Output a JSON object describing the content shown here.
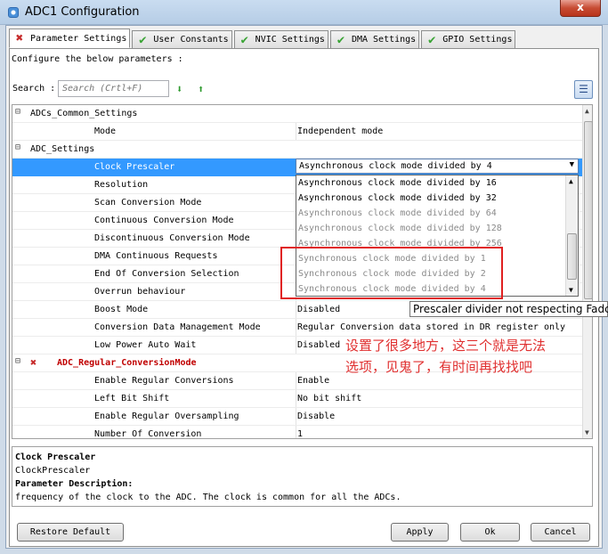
{
  "window": {
    "title": "ADC1 Configuration",
    "close_glyph": "x"
  },
  "tabs": [
    {
      "label": "Parameter Settings",
      "icon": "error-x-icon",
      "active": true
    },
    {
      "label": "User Constants",
      "icon": "check-icon"
    },
    {
      "label": "NVIC Settings",
      "icon": "check-icon"
    },
    {
      "label": "DMA Settings",
      "icon": "check-icon"
    },
    {
      "label": "GPIO Settings",
      "icon": "check-icon"
    }
  ],
  "config_label": "Configure the below parameters :",
  "search": {
    "label": "Search :",
    "placeholder": "Search (Crtl+F)"
  },
  "grid": {
    "groups": {
      "common": "ADCs_Common_Settings",
      "adc": "ADC_Settings",
      "regular": "ADC_Regular_ConversionMode"
    },
    "rows": [
      {
        "label": "Mode",
        "value": "Independent mode"
      },
      {
        "label": "Clock Prescaler",
        "value": "Asynchronous clock mode divided by 4"
      },
      {
        "label": "Resolution",
        "value": ""
      },
      {
        "label": "Scan Conversion Mode",
        "value": ""
      },
      {
        "label": "Continuous Conversion Mode",
        "value": ""
      },
      {
        "label": "Discontinuous Conversion Mode",
        "value": ""
      },
      {
        "label": "DMA Continuous Requests",
        "value": ""
      },
      {
        "label": "End Of Conversion Selection",
        "value": ""
      },
      {
        "label": "Overrun behaviour",
        "value": ""
      },
      {
        "label": "Boost Mode",
        "value": "Disabled"
      },
      {
        "label": "Conversion Data Management Mode",
        "value": "Regular Conversion data stored in DR register only"
      },
      {
        "label": "Low Power Auto Wait",
        "value": "Disabled"
      },
      {
        "label": "Enable Regular Conversions",
        "value": "Enable"
      },
      {
        "label": "Left Bit Shift",
        "value": "No bit shift"
      },
      {
        "label": "Enable Regular Oversampling",
        "value": "Disable"
      },
      {
        "label": "Number Of Conversion",
        "value": "1"
      }
    ]
  },
  "dropdown": {
    "items": [
      {
        "label": "Asynchronous clock mode divided by 16",
        "enabled": true
      },
      {
        "label": "Asynchronous clock mode divided by 32",
        "enabled": true
      },
      {
        "label": "Asynchronous clock mode divided by 64",
        "enabled": false
      },
      {
        "label": "Asynchronous clock mode divided by 128",
        "enabled": false
      },
      {
        "label": "Asynchronous clock mode divided by 256",
        "enabled": false
      },
      {
        "label": "Synchronous clock mode divided by 1",
        "enabled": false
      },
      {
        "label": "Synchronous clock mode divided by 2",
        "enabled": false
      },
      {
        "label": "Synchronous clock mode divided by 4",
        "enabled": false
      }
    ]
  },
  "tooltip": "Prescaler divider not respecting Fadc",
  "annotation": {
    "line1": "设置了很多地方，这三个就是无法",
    "line2": "选项，见鬼了，有时间再找找吧",
    "color": "#e03030"
  },
  "description": {
    "title": "Clock Prescaler",
    "name": "ClockPrescaler",
    "heading": "Parameter Description:",
    "text": "frequency of the clock to the ADC. The clock is common for all the ADCs."
  },
  "buttons": {
    "restore": "Restore Default",
    "apply": "Apply",
    "ok": "Ok",
    "cancel": "Cancel"
  }
}
